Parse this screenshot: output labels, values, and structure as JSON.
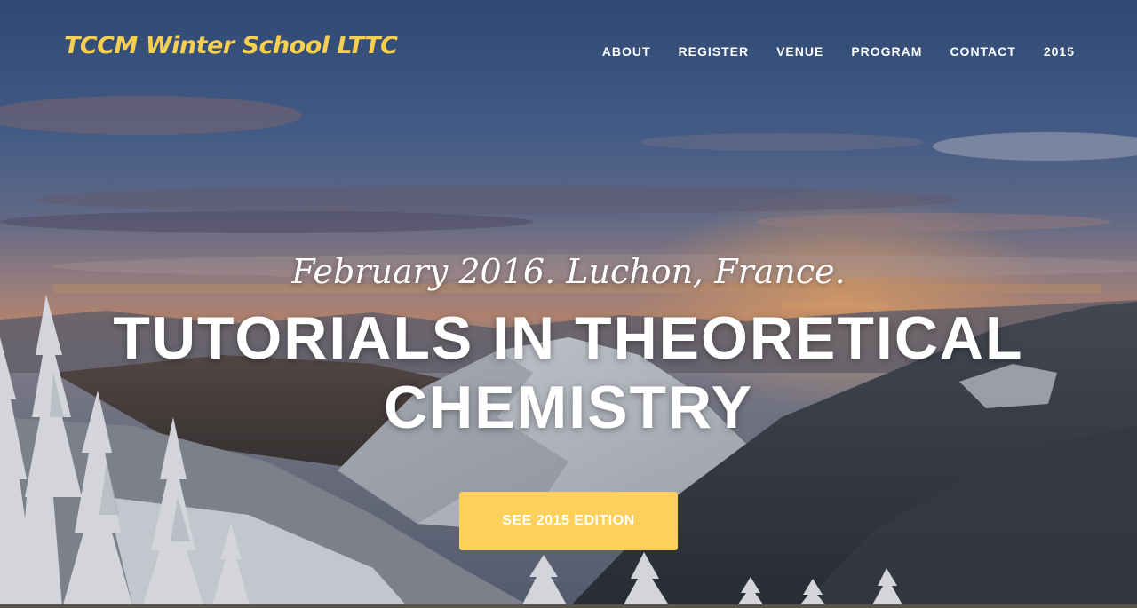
{
  "brand": {
    "name": "TCCM Winter School LTTC",
    "color": "#f7cf4f"
  },
  "nav": {
    "items": [
      {
        "label": "ABOUT"
      },
      {
        "label": "REGISTER"
      },
      {
        "label": "VENUE"
      },
      {
        "label": "PROGRAM"
      },
      {
        "label": "CONTACT"
      },
      {
        "label": "2015"
      }
    ]
  },
  "hero": {
    "subtitle": "February 2016. Luchon, France.",
    "title": "TUTORIALS IN THEORETICAL CHEMISTRY",
    "background": "snowy-mountain-landscape-at-dusk",
    "cta_label": "SEE 2015 EDITION",
    "cta_color": "#fcd05a"
  }
}
